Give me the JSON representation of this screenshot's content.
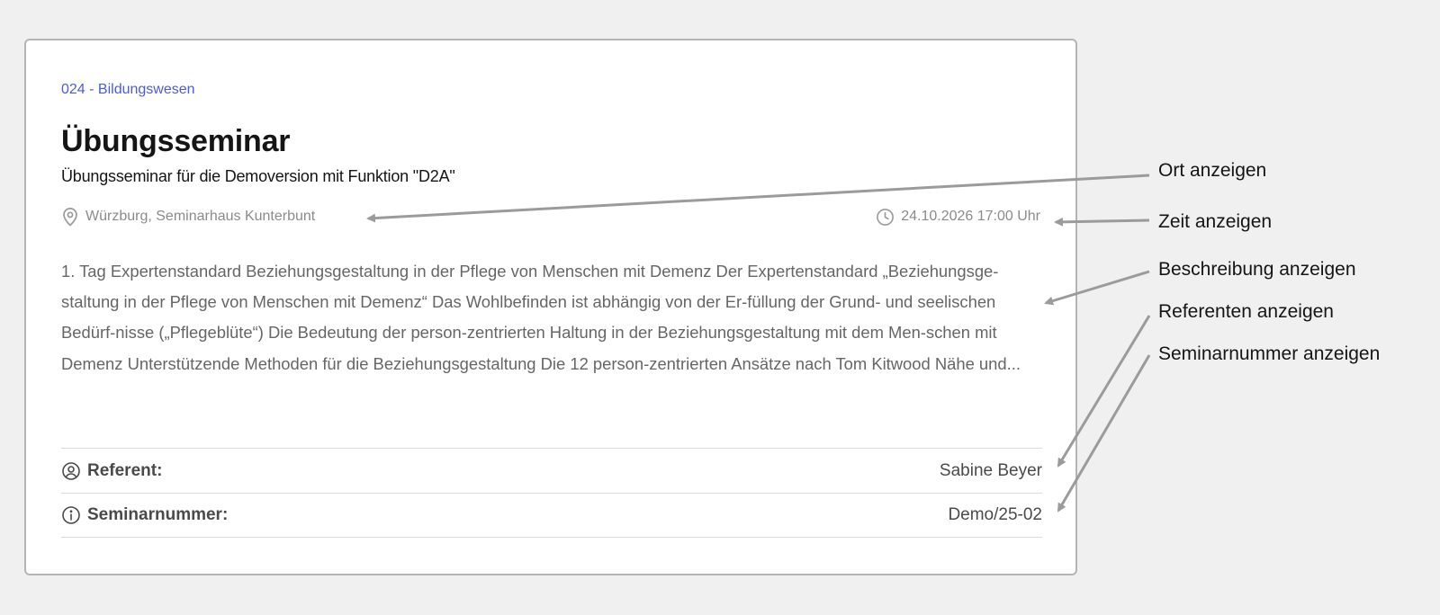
{
  "card": {
    "category": "024 - Bildungswesen",
    "title": "Übungsseminar",
    "subtitle": "Übungsseminar für die Demoversion mit Funktion \"D2A\"",
    "location": "Würzburg, Seminarhaus Kunterbunt",
    "location_icon": "map-pin-icon",
    "datetime": "24.10.2026 17:00 Uhr",
    "datetime_icon": "clock-icon",
    "description": "1. Tag Expertenstandard Beziehungsgestaltung in der Pflege von Menschen mit Demenz Der Expertenstandard „Beziehungsge-staltung in der Pflege von Menschen mit Demenz“ Das Wohlbefinden ist abhängig von der Er-füllung der Grund- und seelischen Bedürf-nisse („Pflegeblüte“) Die Bedeutung der person-zentrierten Haltung in der Beziehungsgestaltung mit dem Men-schen mit Demenz Unterstützende Methoden für die Beziehungsgestaltung Die 12 person-zentrierten Ansätze nach Tom Kitwood Nähe und...",
    "referent_label": "Referent:",
    "referent_icon": "user-circle-icon",
    "referent_value": "Sabine Beyer",
    "seminarnummer_label": "Seminarnummer:",
    "seminarnummer_icon": "info-icon",
    "seminarnummer_value": "Demo/25-02"
  },
  "annotations": {
    "ort": "Ort anzeigen",
    "zeit": "Zeit anzeigen",
    "beschreibung": "Beschreibung anzeigen",
    "referenten": "Referenten anzeigen",
    "seminarnummer": "Seminarnummer anzeigen"
  },
  "colors": {
    "page_background": "#f0f0f0",
    "card_border": "#b4b4b4",
    "category_accent": "#4a5be0",
    "arrow": "#9b9b9b"
  }
}
